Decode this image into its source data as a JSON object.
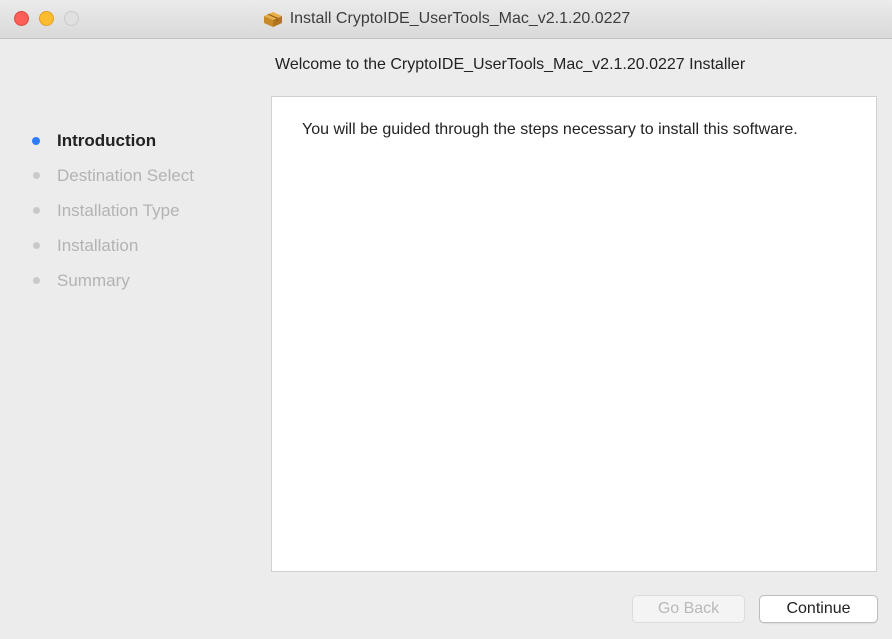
{
  "window": {
    "title": "Install CryptoIDE_UserTools_Mac_v2.1.20.0227",
    "icon": "package-icon"
  },
  "heading": "Welcome to the CryptoIDE_UserTools_Mac_v2.1.20.0227 Installer",
  "steps": [
    {
      "label": "Introduction",
      "active": true
    },
    {
      "label": "Destination Select",
      "active": false
    },
    {
      "label": "Installation Type",
      "active": false
    },
    {
      "label": "Installation",
      "active": false
    },
    {
      "label": "Summary",
      "active": false
    }
  ],
  "content": {
    "text": "You will be guided through the steps necessary to install this software."
  },
  "buttons": {
    "back_label": "Go Back",
    "back_enabled": false,
    "continue_label": "Continue"
  },
  "colors": {
    "accent": "#2f7cf6",
    "close": "#fc5f57",
    "minimize": "#fdbc2e"
  }
}
